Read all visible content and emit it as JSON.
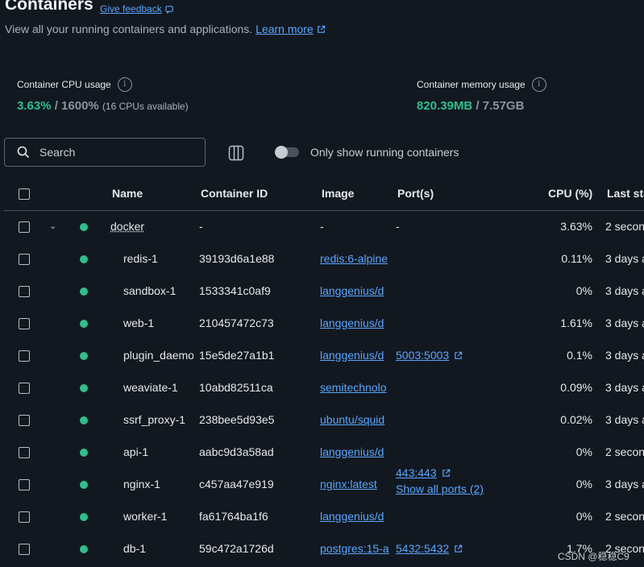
{
  "header": {
    "title": "Containers",
    "feedback_label": "Give feedback",
    "subtitle": "View all your running containers and applications.",
    "learn_more": "Learn more"
  },
  "stats": {
    "cpu": {
      "label": "Container CPU usage",
      "used": "3.63%",
      "total": "/ 1600%",
      "note": "(16 CPUs available)"
    },
    "memory": {
      "label": "Container memory usage",
      "used": "820.39MB",
      "total": "/ 7.57GB"
    }
  },
  "toolbar": {
    "search_placeholder": "Search",
    "toggle_label": "Only show running containers",
    "toggle_on": false
  },
  "table": {
    "columns": [
      "Name",
      "Container ID",
      "Image",
      "Port(s)",
      "CPU (%)",
      "Last sta"
    ],
    "group": {
      "name": "docker",
      "id": "-",
      "image": "-",
      "ports": "-",
      "cpu": "3.63%",
      "last": "2 secon"
    },
    "rows": [
      {
        "name": "redis-1",
        "id": "39193d6a1e88",
        "image": "redis:6-alpine",
        "port": "",
        "port2": "",
        "cpu": "0.11%",
        "last": "3 days a"
      },
      {
        "name": "sandbox-1",
        "id": "1533341c0af9",
        "image": "langgenius/d",
        "port": "",
        "port2": "",
        "cpu": "0%",
        "last": "3 days a"
      },
      {
        "name": "web-1",
        "id": "210457472c73",
        "image": "langgenius/d",
        "port": "",
        "port2": "",
        "cpu": "1.61%",
        "last": "3 days a"
      },
      {
        "name": "plugin_daemo",
        "id": "15e5de27a1b1",
        "image": "langgenius/d",
        "port": "5003:5003",
        "port2": "",
        "cpu": "0.1%",
        "last": "3 days a"
      },
      {
        "name": "weaviate-1",
        "id": "10abd82511ca",
        "image": "semitechnolo",
        "port": "",
        "port2": "",
        "cpu": "0.09%",
        "last": "3 days a"
      },
      {
        "name": "ssrf_proxy-1",
        "id": "238bee5d93e5",
        "image": "ubuntu/squid",
        "port": "",
        "port2": "",
        "cpu": "0.02%",
        "last": "3 days a"
      },
      {
        "name": "api-1",
        "id": "aabc9d3a58ad",
        "image": "langgenius/d",
        "port": "",
        "port2": "",
        "cpu": "0%",
        "last": "2 secon"
      },
      {
        "name": "nginx-1",
        "id": "c457aa47e919",
        "image": "nginx:latest",
        "port": "443:443",
        "port2": "Show all ports (2)",
        "cpu": "0%",
        "last": "3 days a"
      },
      {
        "name": "worker-1",
        "id": "fa61764ba1f6",
        "image": "langgenius/d",
        "port": "",
        "port2": "",
        "cpu": "0%",
        "last": "2 secon"
      },
      {
        "name": "db-1",
        "id": "59c472a1726d",
        "image": "postgres:15-a",
        "port": "5432:5432",
        "port2": "",
        "cpu": "1.7%",
        "last": "2 secon"
      }
    ]
  },
  "watermark": "CSDN @稳稳C9",
  "colors": {
    "background": "#121820",
    "accent": "#5aa6ff",
    "running": "#2fbf8c"
  }
}
